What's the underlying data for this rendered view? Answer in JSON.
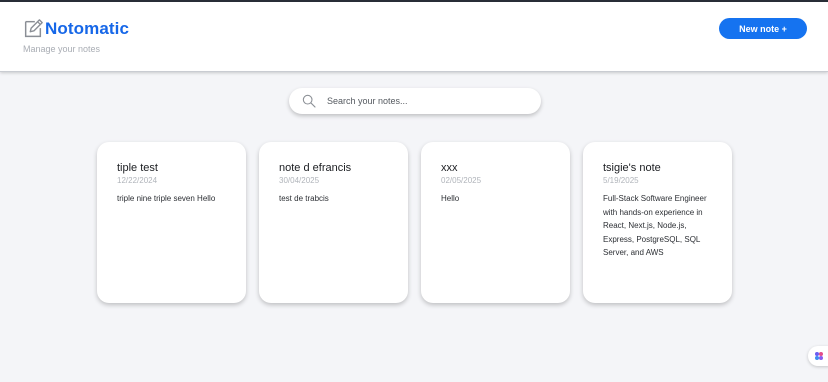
{
  "header": {
    "title": "Notomatic",
    "subtitle": "Manage your notes",
    "new_note_label": "New note +"
  },
  "search": {
    "placeholder": "Search your notes..."
  },
  "notes": [
    {
      "title": "tiple test",
      "date": "12/22/2024",
      "body": "triple nine triple seven Hello"
    },
    {
      "title": "note d efrancis",
      "date": "30/04/2025",
      "body": "test de trabcis"
    },
    {
      "title": "xxx",
      "date": "02/05/2025",
      "body": "Hello"
    },
    {
      "title": "tsigie's note",
      "date": "5/19/2025",
      "body": "Full-Stack Software Engineer with hands-on experience in React, Next.js, Node.js, Express, PostgreSQL, SQL Server, and AWS"
    }
  ],
  "icons": {
    "brand": "notepad-pencil-icon",
    "search": "search-icon",
    "assistant": "assistant-icon"
  },
  "colors": {
    "accent": "#1573f0",
    "brand_text": "#1667e8",
    "background": "#f4f5f8"
  }
}
